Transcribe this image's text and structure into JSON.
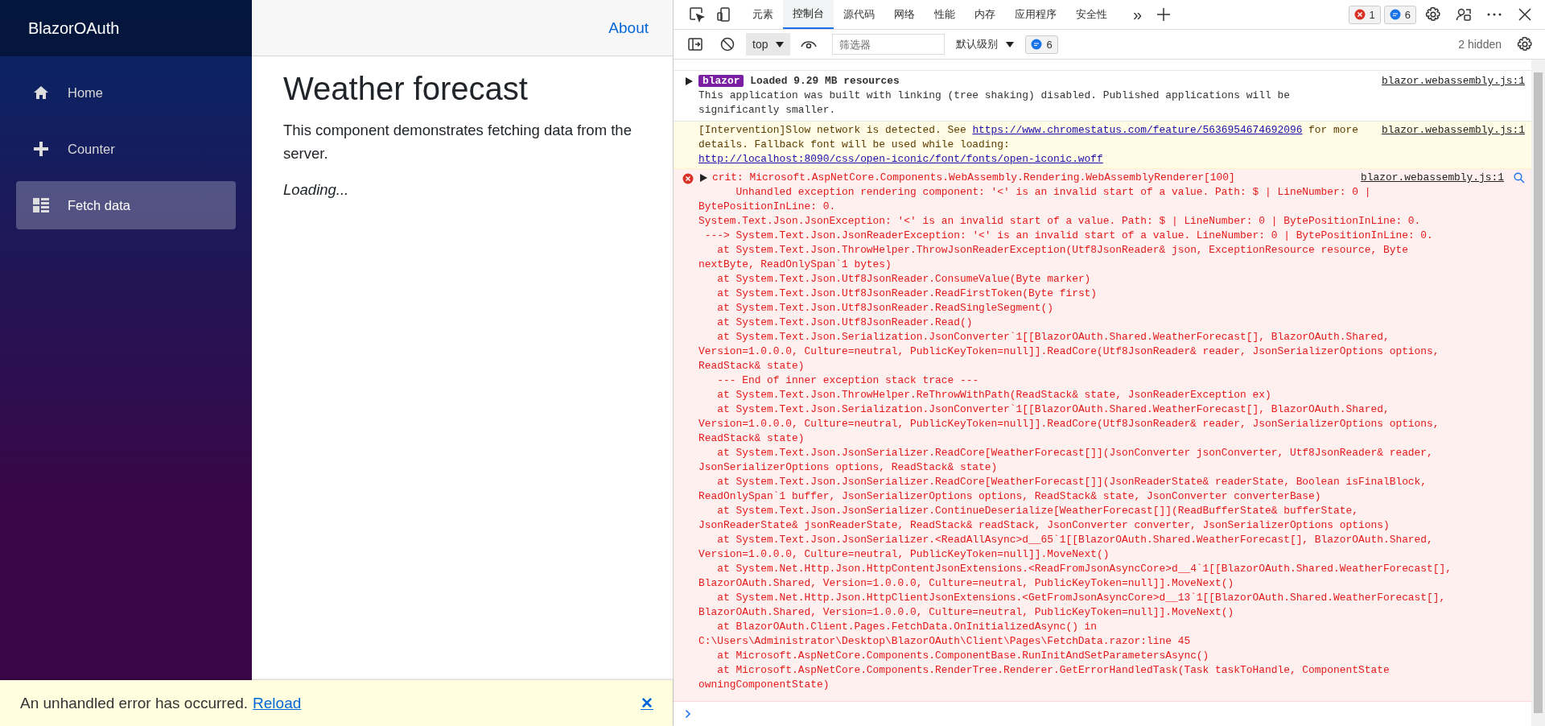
{
  "app": {
    "brand": "BlazorOAuth",
    "nav": [
      {
        "label": "Home",
        "selected": false
      },
      {
        "label": "Counter",
        "selected": false
      },
      {
        "label": "Fetch data",
        "selected": true
      }
    ],
    "top_link": "About",
    "heading": "Weather forecast",
    "description": "This component demonstrates fetching data from the server.",
    "loading": "Loading...",
    "error_bar": {
      "message": "An unhandled error has occurred.",
      "link": "Reload",
      "close": "✕"
    }
  },
  "devtools": {
    "tabs": [
      {
        "label": "元素",
        "selected": false
      },
      {
        "label": "控制台",
        "selected": true
      },
      {
        "label": "源代码",
        "selected": false
      },
      {
        "label": "网络",
        "selected": false
      },
      {
        "label": "性能",
        "selected": false
      },
      {
        "label": "内存",
        "selected": false
      },
      {
        "label": "应用程序",
        "selected": false
      },
      {
        "label": "安全性",
        "selected": false
      }
    ],
    "more": "»",
    "error_count": "1",
    "message_count": "6",
    "toolbar": {
      "context": "top",
      "filter_placeholder": "筛选器",
      "level": "默认级别",
      "message_count": "6",
      "hidden": "2 hidden"
    },
    "messages": [
      {
        "kind": "info",
        "expanded": false,
        "badge": "blazor",
        "title": "Loaded 9.29 MB resources",
        "text": "This application was built with linking (tree shaking) disabled. Published applications will be significantly smaller.",
        "source": "blazor.webassembly.js:1"
      },
      {
        "kind": "warning",
        "parts": [
          {
            "text": "[Intervention]Slow network is detected. See "
          },
          {
            "link": "https://www.chromestatus.com/feature/5636954674692096"
          },
          {
            "text": " for more details. Fallback font will be used while loading: "
          },
          {
            "link": "http://localhost:8090/css/open-iconic/font/fonts/open-iconic.woff"
          }
        ],
        "source": "blazor.webassembly.js:1"
      },
      {
        "kind": "error",
        "expanded": false,
        "header": "crit: Microsoft.AspNetCore.Components.WebAssembly.Rendering.WebAssemblyRenderer[100]",
        "source": "blazor.webassembly.js:1",
        "lines": [
          "      Unhandled exception rendering component: '<' is an invalid start of a value. Path: $ | LineNumber: 0 | BytePositionInLine: 0.",
          "System.Text.Json.JsonException: '<' is an invalid start of a value. Path: $ | LineNumber: 0 | BytePositionInLine: 0.",
          " ---> System.Text.Json.JsonReaderException: '<' is an invalid start of a value. LineNumber: 0 | BytePositionInLine: 0.",
          "   at System.Text.Json.ThrowHelper.ThrowJsonReaderException(Utf8JsonReader& json, ExceptionResource resource, Byte nextByte, ReadOnlySpan`1 bytes)",
          "   at System.Text.Json.Utf8JsonReader.ConsumeValue(Byte marker)",
          "   at System.Text.Json.Utf8JsonReader.ReadFirstToken(Byte first)",
          "   at System.Text.Json.Utf8JsonReader.ReadSingleSegment()",
          "   at System.Text.Json.Utf8JsonReader.Read()",
          "   at System.Text.Json.Serialization.JsonConverter`1[[BlazorOAuth.Shared.WeatherForecast[], BlazorOAuth.Shared, Version=1.0.0.0, Culture=neutral, PublicKeyToken=null]].ReadCore(Utf8JsonReader& reader, JsonSerializerOptions options, ReadStack& state)",
          "   --- End of inner exception stack trace ---",
          "   at System.Text.Json.ThrowHelper.ReThrowWithPath(ReadStack& state, JsonReaderException ex)",
          "   at System.Text.Json.Serialization.JsonConverter`1[[BlazorOAuth.Shared.WeatherForecast[], BlazorOAuth.Shared, Version=1.0.0.0, Culture=neutral, PublicKeyToken=null]].ReadCore(Utf8JsonReader& reader, JsonSerializerOptions options, ReadStack& state)",
          "   at System.Text.Json.JsonSerializer.ReadCore[WeatherForecast[]](JsonConverter jsonConverter, Utf8JsonReader& reader, JsonSerializerOptions options, ReadStack& state)",
          "   at System.Text.Json.JsonSerializer.ReadCore[WeatherForecast[]](JsonReaderState& readerState, Boolean isFinalBlock, ReadOnlySpan`1 buffer, JsonSerializerOptions options, ReadStack& state, JsonConverter converterBase)",
          "   at System.Text.Json.JsonSerializer.ContinueDeserialize[WeatherForecast[]](ReadBufferState& bufferState, JsonReaderState& jsonReaderState, ReadStack& readStack, JsonConverter converter, JsonSerializerOptions options)",
          "   at System.Text.Json.JsonSerializer.<ReadAllAsync>d__65`1[[BlazorOAuth.Shared.WeatherForecast[], BlazorOAuth.Shared, Version=1.0.0.0, Culture=neutral, PublicKeyToken=null]].MoveNext()",
          "   at System.Net.Http.Json.HttpContentJsonExtensions.<ReadFromJsonAsyncCore>d__4`1[[BlazorOAuth.Shared.WeatherForecast[], BlazorOAuth.Shared, Version=1.0.0.0, Culture=neutral, PublicKeyToken=null]].MoveNext()",
          "   at System.Net.Http.Json.HttpClientJsonExtensions.<GetFromJsonAsyncCore>d__13`1[[BlazorOAuth.Shared.WeatherForecast[], BlazorOAuth.Shared, Version=1.0.0.0, Culture=neutral, PublicKeyToken=null]].MoveNext()",
          "   at BlazorOAuth.Client.Pages.FetchData.OnInitializedAsync() in C:\\Users\\Administrator\\Desktop\\BlazorOAuth\\Client\\Pages\\FetchData.razor:line 45",
          "   at Microsoft.AspNetCore.Components.ComponentBase.RunInitAndSetParametersAsync()",
          "   at Microsoft.AspNetCore.Components.RenderTree.Renderer.GetErrorHandledTask(Task taskToHandle, ComponentState owningComponentState)"
        ]
      }
    ]
  }
}
